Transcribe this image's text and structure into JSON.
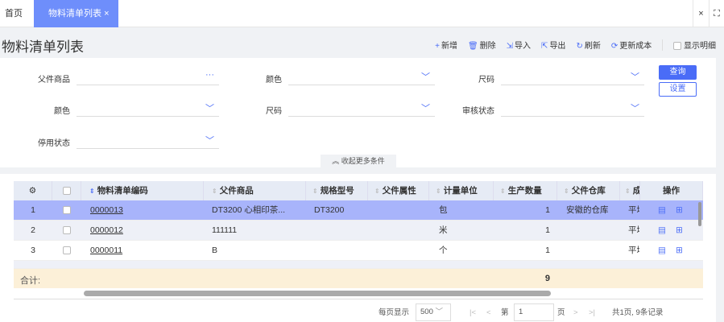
{
  "tabs": {
    "home": "首页",
    "active": "物料清单列表",
    "close": "×",
    "window_close": "×",
    "fullscreen": "⛶"
  },
  "page_title": "物料清单列表",
  "toolbar": [
    {
      "icon": "plus-icon",
      "glyph": "+",
      "label": "新增"
    },
    {
      "icon": "trash-icon",
      "glyph": "🗑",
      "label": "删除"
    },
    {
      "icon": "import-icon",
      "glyph": "⇲",
      "label": "导入"
    },
    {
      "icon": "export-icon",
      "glyph": "⇱",
      "label": "导出"
    },
    {
      "icon": "refresh-icon",
      "glyph": "↻",
      "label": "刷新"
    },
    {
      "icon": "cost-icon",
      "glyph": "⟳",
      "label": "更新成本"
    }
  ],
  "show_detail": "显示明细",
  "filters": {
    "parent_goods": "父件商品",
    "color1": "颜色",
    "size1": "尺码",
    "color2": "颜色",
    "size2": "尺码",
    "audit_status": "审核状态",
    "disable_status": "停用状态",
    "more": "···",
    "collapse": "收起更多条件"
  },
  "buttons": {
    "query": "查询",
    "settings": "设置"
  },
  "table": {
    "headers": [
      "物料清单编码",
      "父件商品",
      "规格型号",
      "父件属性",
      "计量单位",
      "生产数量",
      "父件仓库",
      "成",
      "操作"
    ],
    "rows": [
      {
        "no": "1",
        "code": "0000013",
        "parent": "DT3200 心相印茶...",
        "spec": "DT3200",
        "attr": "",
        "unit": "包",
        "qty": "1",
        "warehouse": "安徽的仓库",
        "cut": "平均"
      },
      {
        "no": "2",
        "code": "0000012",
        "parent": "111111",
        "spec": "",
        "attr": "",
        "unit": "米",
        "qty": "1",
        "warehouse": "",
        "cut": "平均"
      },
      {
        "no": "3",
        "code": "0000011",
        "parent": "B",
        "spec": "",
        "attr": "",
        "unit": "个",
        "qty": "1",
        "warehouse": "",
        "cut": "平均"
      }
    ],
    "summary_label": "合计:",
    "summary_qty": "9"
  },
  "pager": {
    "per_page_label": "每页显示",
    "per_page": "500",
    "page_prefix": "第",
    "page": "1",
    "page_suffix": "页",
    "total": "共1页, 9条记录"
  },
  "colors": {
    "accent": "#4a6cf7",
    "active_tab": "#6e8efb",
    "selected_row": "#a8b4fb",
    "summary": "#fcf0d8"
  }
}
